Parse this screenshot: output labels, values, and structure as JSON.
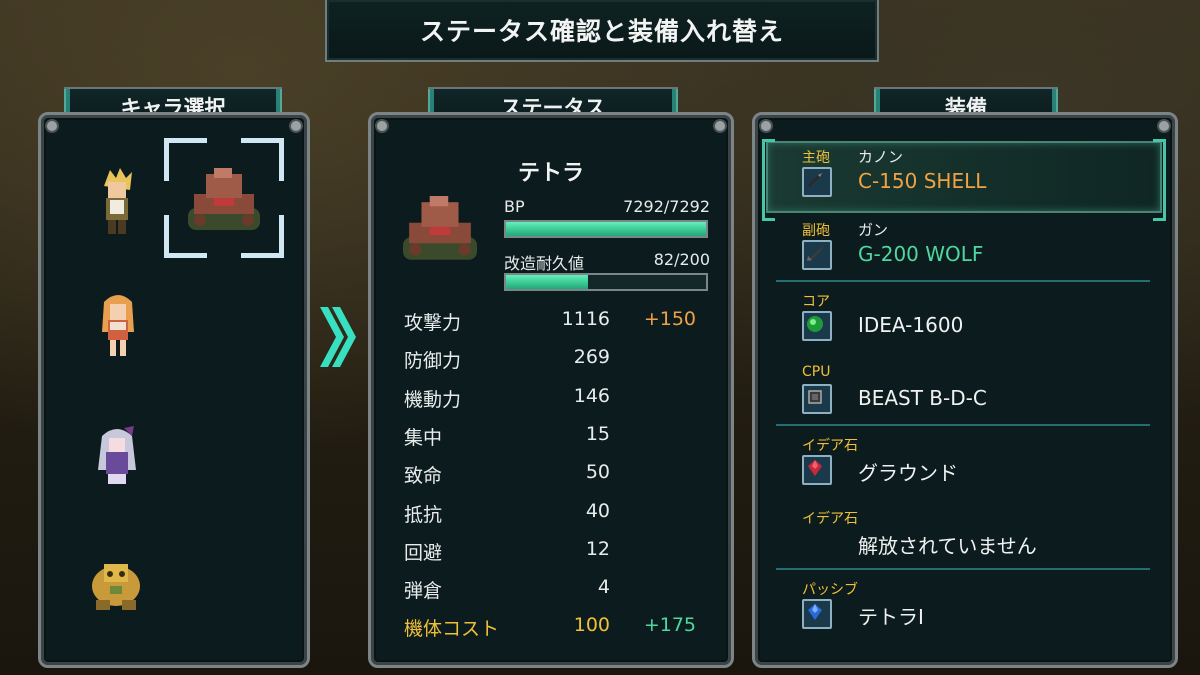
{
  "title": "ステータス確認と装備入れ替え",
  "tabs": {
    "chars": "キャラ選択",
    "status": "ステータス",
    "equip": "装備"
  },
  "unit": {
    "name": "テトラ",
    "bp_label": "BP",
    "bp_value": "7292/7292",
    "bp_fraction": 1.0,
    "dur_label": "改造耐久値",
    "dur_value": "82/200",
    "dur_fraction": 0.41
  },
  "stats": [
    {
      "name": "攻撃力",
      "value": "1116",
      "bonus": "+150"
    },
    {
      "name": "防御力",
      "value": "269",
      "bonus": ""
    },
    {
      "name": "機動力",
      "value": "146",
      "bonus": ""
    },
    {
      "name": "集中",
      "value": "15",
      "bonus": ""
    },
    {
      "name": "致命",
      "value": "50",
      "bonus": ""
    },
    {
      "name": "抵抗",
      "value": "40",
      "bonus": ""
    },
    {
      "name": "回避",
      "value": "12",
      "bonus": ""
    },
    {
      "name": "弾倉",
      "value": "4",
      "bonus": ""
    },
    {
      "name": "機体コスト",
      "value": "100",
      "bonus": "+175"
    }
  ],
  "equipment": [
    {
      "category": "主砲",
      "sub": "カノン",
      "name": "C-150 SHELL",
      "icon": "shell-icon",
      "name_color": "#f1a243"
    },
    {
      "category": "副砲",
      "sub": "ガン",
      "name": "G-200 WOLF",
      "icon": "missile-icon",
      "name_color": "#4ed8a0"
    },
    {
      "category": "コア",
      "sub": "",
      "name": "IDEA-1600",
      "icon": "core-orb-icon",
      "name_color": "#f0f2f2"
    },
    {
      "category": "CPU",
      "sub": "",
      "name": "BEAST B-D-C",
      "icon": "cpu-chip-icon",
      "name_color": "#f0f2f2"
    },
    {
      "category": "イデア石",
      "sub": "",
      "name": "グラウンド",
      "icon": "red-gem-icon",
      "name_color": "#f0f2f2"
    },
    {
      "category": "イデア石",
      "sub": "",
      "name": "解放されていません",
      "icon": "",
      "name_color": "#f0f2f2"
    },
    {
      "category": "パッシブ",
      "sub": "",
      "name": "テトラI",
      "icon": "blue-gem-icon",
      "name_color": "#f0f2f2"
    }
  ],
  "characters": [
    "blonde-boy-sprite",
    "orange-hair-girl-sprite",
    "silver-hair-girl-sprite",
    "golden-robot-sprite",
    "tank-sprite"
  ]
}
